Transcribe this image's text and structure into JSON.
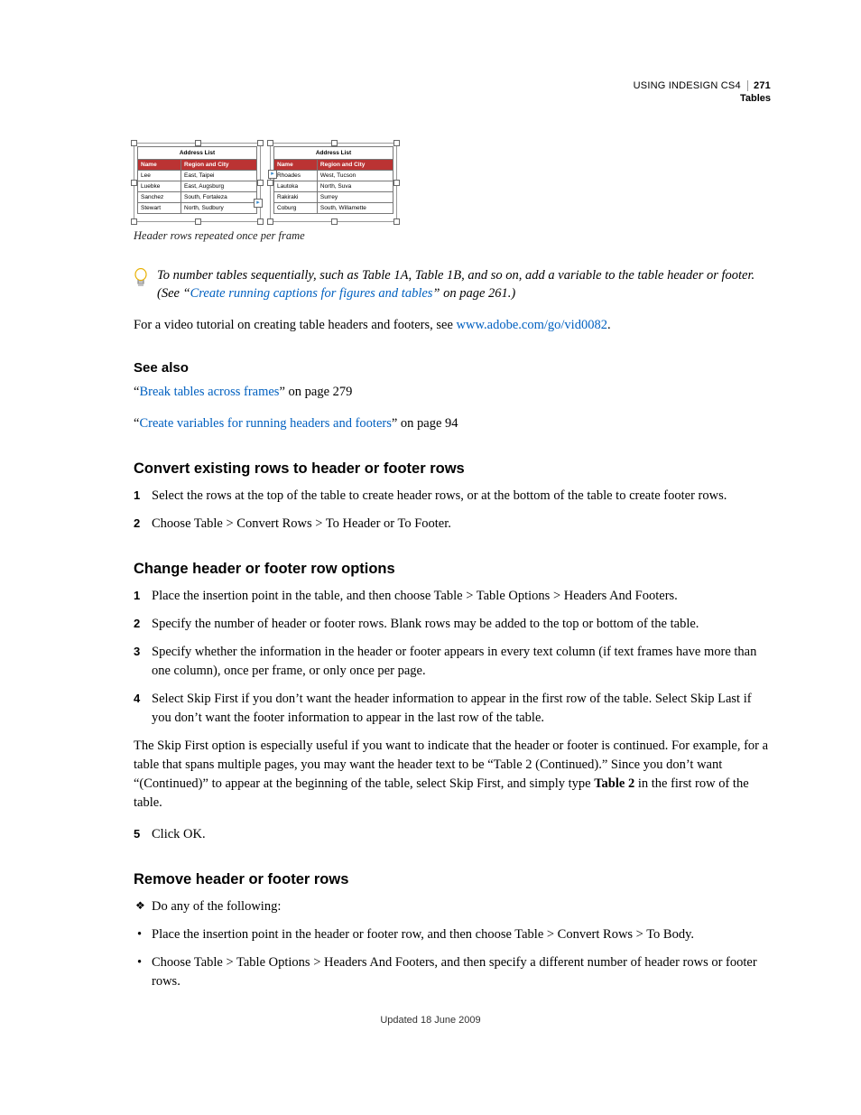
{
  "header": {
    "product": "USING INDESIGN CS4",
    "page_number": "271",
    "section": "Tables"
  },
  "figure": {
    "caption": "Header rows repeated once per frame",
    "title": "Address List",
    "col1": "Name",
    "col2": "Region and City",
    "left_rows": [
      [
        "Lee",
        "East, Taipei"
      ],
      [
        "Luebke",
        "East, Augsburg"
      ],
      [
        "Sanchez",
        "South, Fortaleza"
      ],
      [
        "Stewart",
        "North, Sudbury"
      ]
    ],
    "right_rows": [
      [
        "Rhoades",
        "West, Tucson"
      ],
      [
        "Lautoka",
        "North, Suva"
      ],
      [
        "Rakiraki",
        "Surrey"
      ],
      [
        "Coburg",
        "South, Willamette"
      ]
    ]
  },
  "tip": {
    "text_before": "To number tables sequentially, such as Table 1A, Table 1B, and so on, add a variable to the table header or footer. (See “",
    "link_text": "Create running captions for figures and tables",
    "text_after": "” on page 261.)"
  },
  "video_line": {
    "before": "For a video tutorial on creating table headers and footers, see ",
    "link": "www.adobe.com/go/vid0082",
    "after": "."
  },
  "see_also": {
    "heading": "See also",
    "items": [
      {
        "q1": "“",
        "link": "Break tables across frames",
        "q2": "” on page 279"
      },
      {
        "q1": "“",
        "link": "Create variables for running headers and footers",
        "q2": "” on page 94"
      }
    ]
  },
  "section_convert": {
    "heading": "Convert existing rows to header or footer rows",
    "steps": [
      "Select the rows at the top of the table to create header rows, or at the bottom of the table to create footer rows.",
      "Choose Table > Convert Rows > To Header or To Footer."
    ]
  },
  "section_change": {
    "heading": "Change header or footer row options",
    "steps": [
      "Place the insertion point in the table, and then choose Table > Table Options > Headers And Footers.",
      "Specify the number of header or footer rows. Blank rows may be added to the top or bottom of the table.",
      "Specify whether the information in the header or footer appears in every text column (if text frames have more than one column), once per frame, or only once per page.",
      "Select Skip First if you don’t want the header information to appear in the first row of the table. Select Skip Last if you don’t want the footer information to appear in the last row of the table."
    ],
    "para_before": "The Skip First option is especially useful if you want to indicate that the header or footer is continued. For example, for a table that spans multiple pages, you may want the header text to be “Table 2 (Continued).” Since you don’t want “(Continued)” to appear at the beginning of the table, select Skip First, and simply type ",
    "para_bold": "Table 2",
    "para_after": " in the first row of the table.",
    "step5": "Click OK."
  },
  "section_remove": {
    "heading": "Remove header or footer rows",
    "lead": "Do any of the following:",
    "bullets": [
      "Place the insertion point in the header or footer row, and then choose Table > Convert Rows > To Body.",
      "Choose Table > Table Options > Headers And Footers, and then specify a different number of header rows or footer rows."
    ]
  },
  "footer": {
    "updated": "Updated 18 June 2009"
  }
}
